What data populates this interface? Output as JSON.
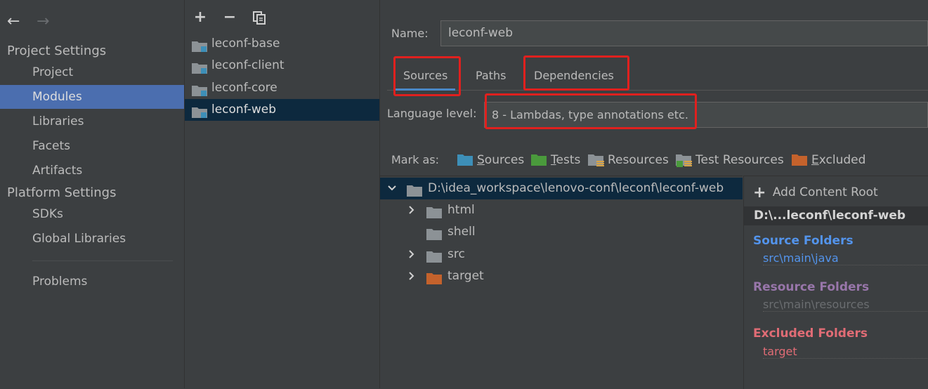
{
  "sidebar": {
    "back_icon": "←",
    "forward_icon": "→",
    "project_settings": "Project Settings",
    "project_items": [
      "Project",
      "Modules",
      "Libraries",
      "Facets",
      "Artifacts"
    ],
    "platform_settings": "Platform Settings",
    "platform_items": [
      "SDKs",
      "Global Libraries"
    ],
    "problems": "Problems",
    "selected": "Modules"
  },
  "modules": {
    "toolbar": {
      "add_icon": "+",
      "remove_icon": "−",
      "copy_icon": "copy"
    },
    "items": [
      "leconf-base",
      "leconf-client",
      "leconf-core",
      "leconf-web"
    ],
    "selected": "leconf-web"
  },
  "content": {
    "name_label": "Name:",
    "name_value": "leconf-web",
    "tabs": [
      "Sources",
      "Paths",
      "Dependencies"
    ],
    "active_tab": "Sources",
    "language_level_label": "Language level:",
    "language_level_value": "8 - Lambdas, type annotations etc.",
    "mark_as_label": "Mark as:",
    "mark_as": [
      {
        "key": "S",
        "rest": "ources",
        "icon": "sources-folder-icon",
        "color": "#3d8fb8"
      },
      {
        "key": "T",
        "rest": "ests",
        "icon": "tests-folder-icon",
        "color": "#4a9a3c"
      },
      {
        "key": "",
        "rest": "Resources",
        "icon": "resources-folder-icon",
        "color": "#8c9296"
      },
      {
        "key": "",
        "rest": "Test Resources",
        "icon": "test-resources-folder-icon",
        "color": "#8c9296"
      },
      {
        "key": "E",
        "rest": "xcluded",
        "icon": "excluded-folder-icon",
        "color": "#c4622c"
      }
    ],
    "tree": {
      "root": "D:\\idea_workspace\\lenovo-conf\\leconf\\leconf-web",
      "children": [
        {
          "name": "html",
          "expandable": true,
          "color": "#8c9296"
        },
        {
          "name": "shell",
          "expandable": false,
          "color": "#8c9296"
        },
        {
          "name": "src",
          "expandable": true,
          "color": "#8c9296"
        },
        {
          "name": "target",
          "expandable": true,
          "color": "#c4622c"
        }
      ]
    },
    "roots": {
      "add_content_root": "Add Content Root",
      "add_key": "C",
      "root_path": "D:\\...leconf\\leconf-web",
      "source_folders_title": "Source Folders",
      "source_folders": [
        "src\\main\\java"
      ],
      "resource_folders_title": "Resource Folders",
      "resource_folders": [
        "src\\main\\resources"
      ],
      "excluded_folders_title": "Excluded Folders",
      "excluded_folders": [
        "target"
      ],
      "colors": {
        "source": "#5394ec",
        "resource": "#9876aa",
        "excluded": "#e06c75"
      }
    }
  },
  "colors": {
    "selection": "#4b6eaf",
    "tree_selection": "#0d293e",
    "highlight_box": "#e0201e",
    "accent": "#4a88c7"
  }
}
